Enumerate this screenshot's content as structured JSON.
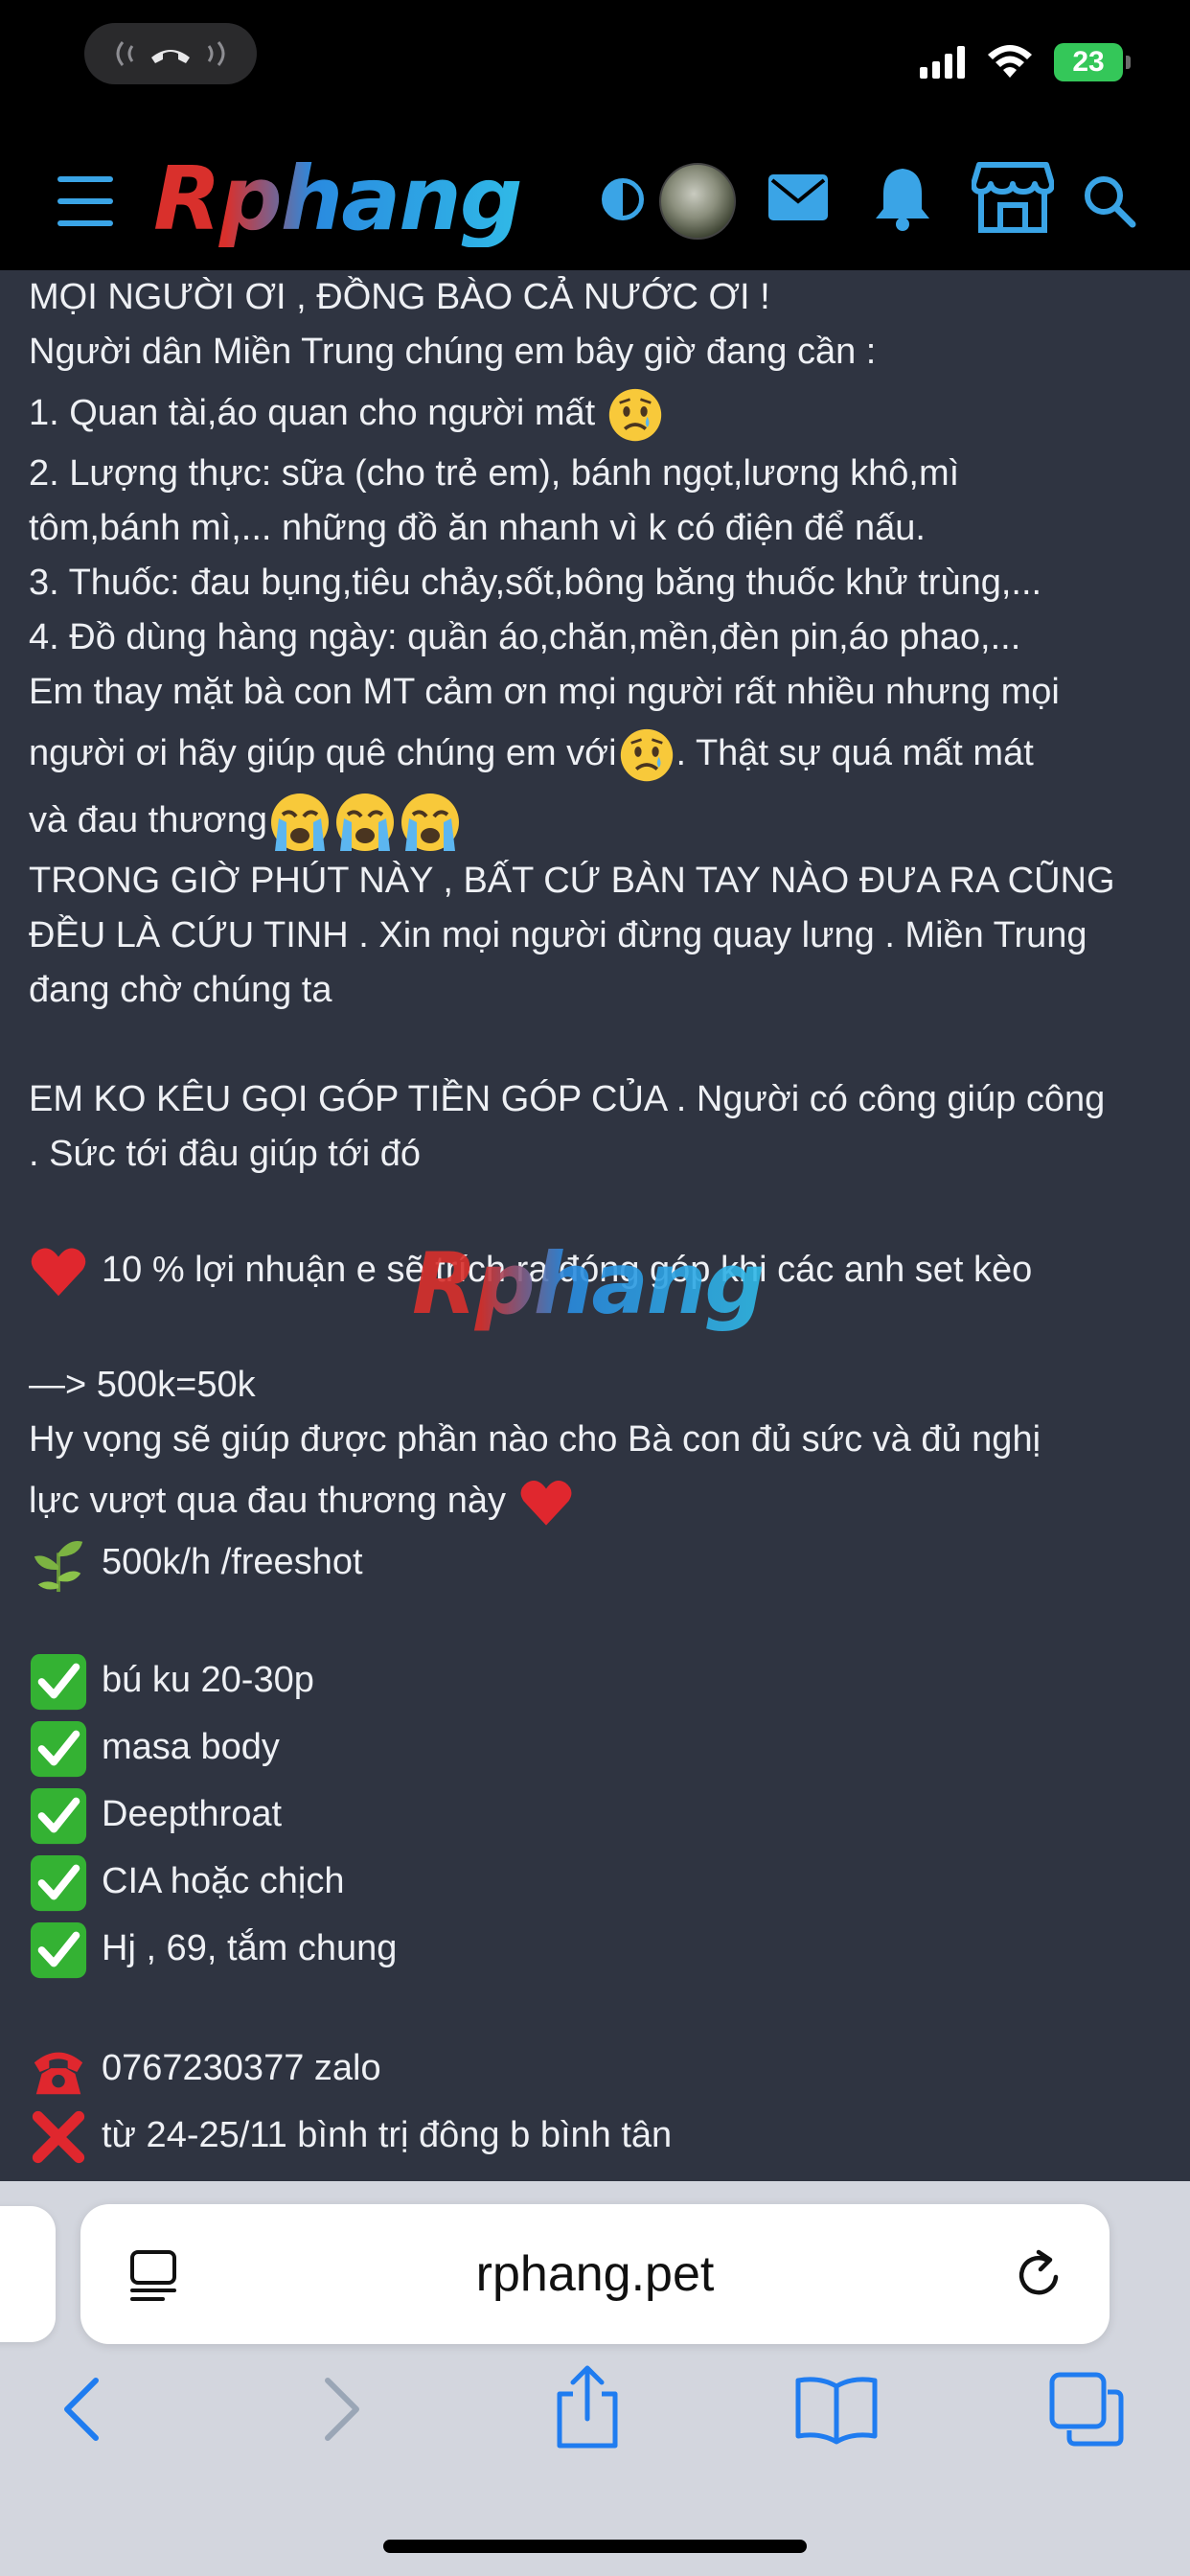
{
  "status_bar": {
    "battery": "23"
  },
  "header": {
    "logo_text": "Rphang"
  },
  "post": {
    "lines": [
      "MỌI NGƯỜI ƠI , ĐỒNG BÀO CẢ NƯỚC ƠI !",
      "Người dân Miền Trung chúng em bây giờ đang cần :",
      "1. Quan tài,áo quan cho người mất",
      "2. Lượng thực: sữa (cho trẻ em), bánh ngọt,lương khô,mì",
      "tôm,bánh mì,... những đồ ăn nhanh vì k có điện để nấu.",
      "3. Thuốc: đau bụng,tiêu chảy,sốt,bông băng thuốc khử trùng,...",
      "4. Đồ dùng hàng ngày: quần áo,chăn,mền,đèn pin,áo phao,...",
      "Em thay mặt bà con MT cảm ơn mọi người rất nhiều nhưng mọi",
      "người ơi hãy giúp quê chúng em với",
      ". Thật sự quá mất mát",
      "và đau thương",
      "TRONG GIỜ PHÚT NÀY , BẤT CỨ BÀN TAY NÀO ĐƯA RA CŨNG",
      "ĐỀU LÀ CỨU TINH . Xin mọi người đừng quay lưng . Miền Trung",
      "đang chờ chúng ta",
      "EM KO KÊU GỌI GÓP TIỀN GÓP CỦA . Người có công giúp công",
      ". Sức tới đâu giúp tới đó",
      "10 % lợi nhuận e sẽ trích ra đóng góp khi các anh set kèo",
      "—> 500k=50k",
      "Hy vọng sẽ giúp được phần nào cho Bà con đủ sức và đủ nghị",
      "lực vượt qua đau thương này",
      "500k/h /freeshot",
      "bú ku 20-30p",
      "masa body",
      "Deepthroat",
      "CIA hoặc chịch",
      "Hj , 69, tắm chung",
      "0767230377 zalo",
      "từ 24-25/11 bình trị đông b bình tân"
    ]
  },
  "watermark": "Rphang",
  "browser": {
    "url": "rphang.pet"
  },
  "colors": {
    "accent": "#3aa4e6",
    "page_bg": "#2f3441",
    "check_green": "#34b233",
    "heart_red": "#e0272e"
  }
}
